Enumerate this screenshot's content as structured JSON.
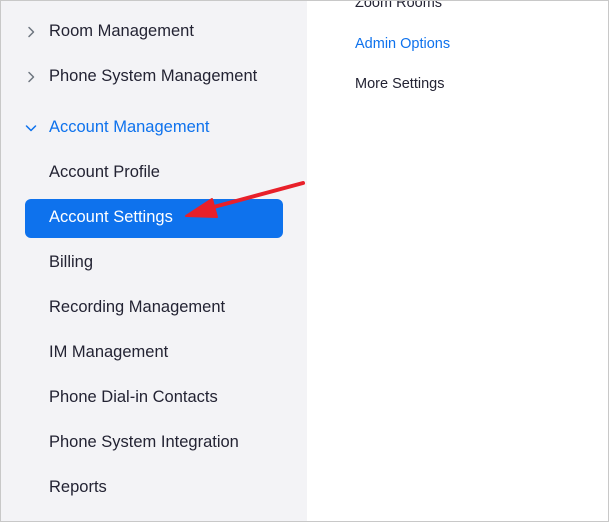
{
  "sidebar": {
    "items": [
      {
        "label": "Room Management",
        "chevron": "chevron-right-icon"
      },
      {
        "label": "Phone System Management",
        "chevron": "chevron-right-icon"
      },
      {
        "label": "Account Management",
        "chevron": "chevron-down-icon",
        "expanded": true
      }
    ],
    "sub_items": [
      {
        "label": "Account Profile"
      },
      {
        "label": "Account Settings",
        "active": true
      },
      {
        "label": "Billing"
      },
      {
        "label": "Recording Management"
      },
      {
        "label": "IM Management"
      },
      {
        "label": "Phone Dial-in Contacts"
      },
      {
        "label": "Phone System Integration"
      },
      {
        "label": "Reports"
      }
    ]
  },
  "content": {
    "links": [
      {
        "label": "Zoom Rooms"
      },
      {
        "label": "Admin Options"
      },
      {
        "label": "More Settings"
      }
    ]
  },
  "annotation": {
    "type": "arrow",
    "color": "#e8202a",
    "points_to": "Account Settings"
  },
  "colors": {
    "accent": "#0e72ed",
    "sidebar_bg": "#f3f3f6",
    "text": "#232333",
    "arrow": "#e8202a"
  }
}
